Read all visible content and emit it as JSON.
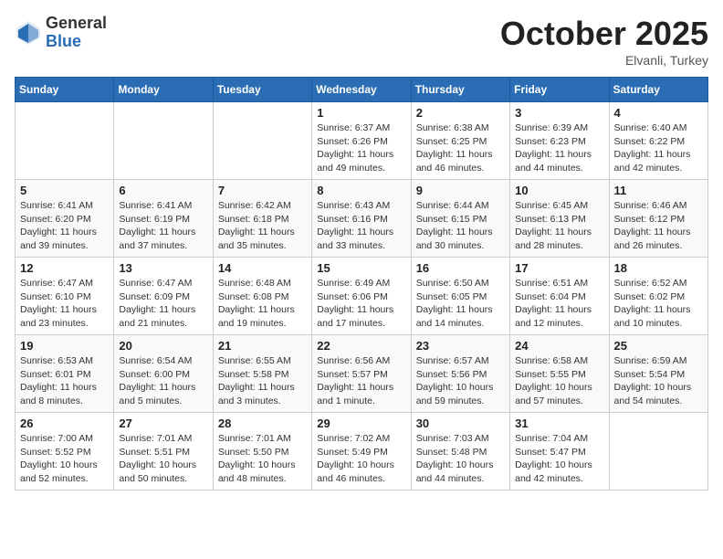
{
  "header": {
    "logo_general": "General",
    "logo_blue": "Blue",
    "month_title": "October 2025",
    "subtitle": "Elvanli, Turkey"
  },
  "days_of_week": [
    "Sunday",
    "Monday",
    "Tuesday",
    "Wednesday",
    "Thursday",
    "Friday",
    "Saturday"
  ],
  "weeks": [
    [
      {
        "day": "",
        "info": ""
      },
      {
        "day": "",
        "info": ""
      },
      {
        "day": "",
        "info": ""
      },
      {
        "day": "1",
        "info": "Sunrise: 6:37 AM\nSunset: 6:26 PM\nDaylight: 11 hours and 49 minutes."
      },
      {
        "day": "2",
        "info": "Sunrise: 6:38 AM\nSunset: 6:25 PM\nDaylight: 11 hours and 46 minutes."
      },
      {
        "day": "3",
        "info": "Sunrise: 6:39 AM\nSunset: 6:23 PM\nDaylight: 11 hours and 44 minutes."
      },
      {
        "day": "4",
        "info": "Sunrise: 6:40 AM\nSunset: 6:22 PM\nDaylight: 11 hours and 42 minutes."
      }
    ],
    [
      {
        "day": "5",
        "info": "Sunrise: 6:41 AM\nSunset: 6:20 PM\nDaylight: 11 hours and 39 minutes."
      },
      {
        "day": "6",
        "info": "Sunrise: 6:41 AM\nSunset: 6:19 PM\nDaylight: 11 hours and 37 minutes."
      },
      {
        "day": "7",
        "info": "Sunrise: 6:42 AM\nSunset: 6:18 PM\nDaylight: 11 hours and 35 minutes."
      },
      {
        "day": "8",
        "info": "Sunrise: 6:43 AM\nSunset: 6:16 PM\nDaylight: 11 hours and 33 minutes."
      },
      {
        "day": "9",
        "info": "Sunrise: 6:44 AM\nSunset: 6:15 PM\nDaylight: 11 hours and 30 minutes."
      },
      {
        "day": "10",
        "info": "Sunrise: 6:45 AM\nSunset: 6:13 PM\nDaylight: 11 hours and 28 minutes."
      },
      {
        "day": "11",
        "info": "Sunrise: 6:46 AM\nSunset: 6:12 PM\nDaylight: 11 hours and 26 minutes."
      }
    ],
    [
      {
        "day": "12",
        "info": "Sunrise: 6:47 AM\nSunset: 6:10 PM\nDaylight: 11 hours and 23 minutes."
      },
      {
        "day": "13",
        "info": "Sunrise: 6:47 AM\nSunset: 6:09 PM\nDaylight: 11 hours and 21 minutes."
      },
      {
        "day": "14",
        "info": "Sunrise: 6:48 AM\nSunset: 6:08 PM\nDaylight: 11 hours and 19 minutes."
      },
      {
        "day": "15",
        "info": "Sunrise: 6:49 AM\nSunset: 6:06 PM\nDaylight: 11 hours and 17 minutes."
      },
      {
        "day": "16",
        "info": "Sunrise: 6:50 AM\nSunset: 6:05 PM\nDaylight: 11 hours and 14 minutes."
      },
      {
        "day": "17",
        "info": "Sunrise: 6:51 AM\nSunset: 6:04 PM\nDaylight: 11 hours and 12 minutes."
      },
      {
        "day": "18",
        "info": "Sunrise: 6:52 AM\nSunset: 6:02 PM\nDaylight: 11 hours and 10 minutes."
      }
    ],
    [
      {
        "day": "19",
        "info": "Sunrise: 6:53 AM\nSunset: 6:01 PM\nDaylight: 11 hours and 8 minutes."
      },
      {
        "day": "20",
        "info": "Sunrise: 6:54 AM\nSunset: 6:00 PM\nDaylight: 11 hours and 5 minutes."
      },
      {
        "day": "21",
        "info": "Sunrise: 6:55 AM\nSunset: 5:58 PM\nDaylight: 11 hours and 3 minutes."
      },
      {
        "day": "22",
        "info": "Sunrise: 6:56 AM\nSunset: 5:57 PM\nDaylight: 11 hours and 1 minute."
      },
      {
        "day": "23",
        "info": "Sunrise: 6:57 AM\nSunset: 5:56 PM\nDaylight: 10 hours and 59 minutes."
      },
      {
        "day": "24",
        "info": "Sunrise: 6:58 AM\nSunset: 5:55 PM\nDaylight: 10 hours and 57 minutes."
      },
      {
        "day": "25",
        "info": "Sunrise: 6:59 AM\nSunset: 5:54 PM\nDaylight: 10 hours and 54 minutes."
      }
    ],
    [
      {
        "day": "26",
        "info": "Sunrise: 7:00 AM\nSunset: 5:52 PM\nDaylight: 10 hours and 52 minutes."
      },
      {
        "day": "27",
        "info": "Sunrise: 7:01 AM\nSunset: 5:51 PM\nDaylight: 10 hours and 50 minutes."
      },
      {
        "day": "28",
        "info": "Sunrise: 7:01 AM\nSunset: 5:50 PM\nDaylight: 10 hours and 48 minutes."
      },
      {
        "day": "29",
        "info": "Sunrise: 7:02 AM\nSunset: 5:49 PM\nDaylight: 10 hours and 46 minutes."
      },
      {
        "day": "30",
        "info": "Sunrise: 7:03 AM\nSunset: 5:48 PM\nDaylight: 10 hours and 44 minutes."
      },
      {
        "day": "31",
        "info": "Sunrise: 7:04 AM\nSunset: 5:47 PM\nDaylight: 10 hours and 42 minutes."
      },
      {
        "day": "",
        "info": ""
      }
    ]
  ]
}
